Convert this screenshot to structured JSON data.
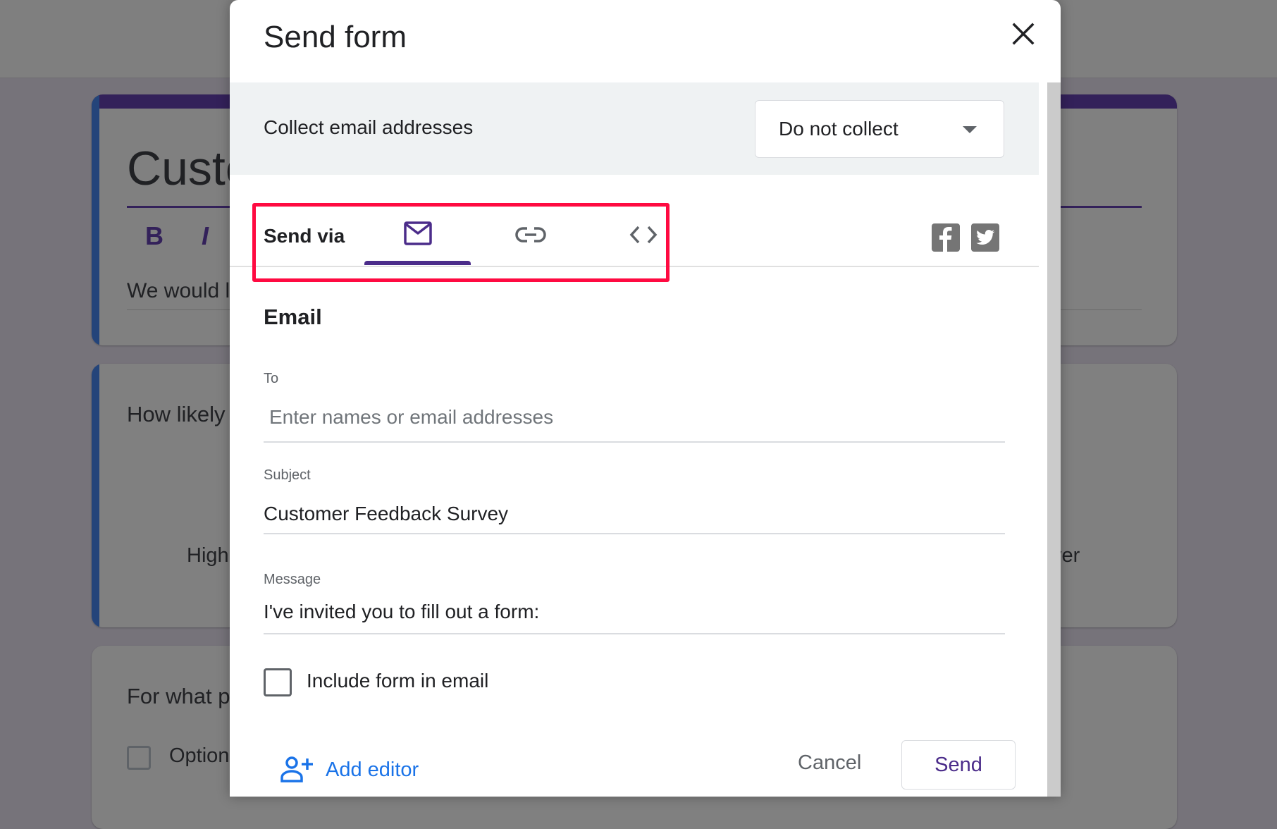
{
  "background_form": {
    "title": "Custo",
    "format_bold": "B",
    "format_italic": "I",
    "description": "We would lo",
    "question1": "How likely",
    "question1_low_label": "High",
    "question1_high_label": "ver",
    "question2": "For what p",
    "question2_option": "Option",
    "theme_color": "#33215a"
  },
  "dialog": {
    "title": "Send form",
    "close_icon": "close-icon",
    "collect": {
      "label": "Collect email addresses",
      "selected": "Do not collect"
    },
    "send_via": {
      "label": "Send via",
      "tabs": [
        {
          "name": "Email",
          "icon": "mail-icon",
          "active": true
        },
        {
          "name": "Link",
          "icon": "link-icon",
          "active": false
        },
        {
          "name": "Embed HTML",
          "icon": "code-icon",
          "active": false
        }
      ],
      "social": [
        "facebook-icon",
        "twitter-icon"
      ]
    },
    "email": {
      "heading": "Email",
      "to_label": "To",
      "to_placeholder": "Enter names or email addresses",
      "to_value": "",
      "subject_label": "Subject",
      "subject_value": "Customer Feedback Survey",
      "message_label": "Message",
      "message_value": "I've invited you to fill out a form:",
      "include_label": "Include form in email",
      "include_checked": false
    },
    "footer": {
      "add_editor": "Add editor",
      "cancel": "Cancel",
      "send": "Send"
    },
    "accent_color": "#4b2c8a",
    "highlight_color": "#ff0a41"
  }
}
